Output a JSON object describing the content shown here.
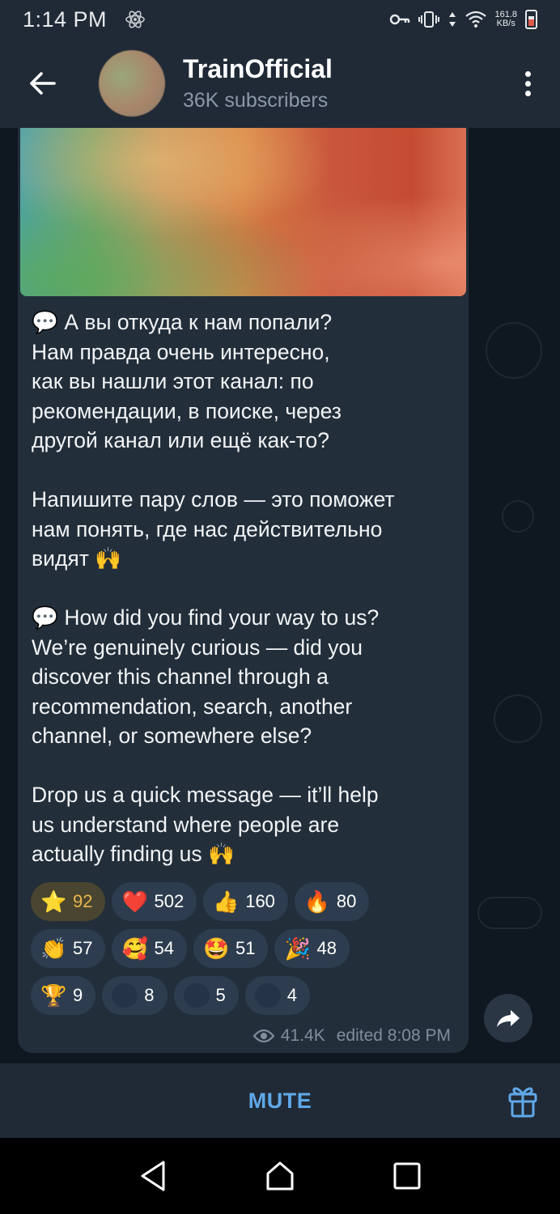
{
  "status_bar": {
    "time": "1:14 PM",
    "net_speed_value": "161.8",
    "net_speed_unit": "KB/s"
  },
  "header": {
    "channel_name": "TrainOfficial",
    "subscribers": "36K subscribers"
  },
  "message": {
    "text": "💬 А вы откуда к нам попали?\nНам правда очень интересно,\nкак вы нашли этот канал: по\nрекомендации, в поиске, через\nдругой канал или ещё как-то?\n\nНапишите пару слов — это поможет\nнам понять, где нас действительно\nвидят 🙌\n\n💬 How did you find your way to us?\nWe’re genuinely curious — did you\ndiscover this channel through a\nrecommendation, search, another\nchannel, or somewhere else?\n\nDrop us a quick message — it’ll help\nus understand where people are\nactually finding us 🙌",
    "views": "41.4K",
    "edited_time": "edited 8:08 PM"
  },
  "reactions": {
    "row1": [
      {
        "emoji": "⭐",
        "count": "92"
      },
      {
        "emoji": "❤️",
        "count": "502"
      },
      {
        "emoji": "👍",
        "count": "160"
      },
      {
        "emoji": "🔥",
        "count": "80"
      }
    ],
    "row2": [
      {
        "emoji": "👏",
        "count": "57"
      },
      {
        "emoji": "🥰",
        "count": "54"
      },
      {
        "emoji": "🤩",
        "count": "51"
      },
      {
        "emoji": "🎉",
        "count": "48"
      }
    ],
    "row3": [
      {
        "emoji": "🏆",
        "count": "9"
      },
      {
        "emoji": "",
        "count": "8"
      },
      {
        "emoji": "",
        "count": "5"
      },
      {
        "emoji": "",
        "count": "4"
      }
    ]
  },
  "bottom_bar": {
    "mute_label": "MUTE"
  },
  "colors": {
    "accent": "#5fa8e8",
    "header_bg": "#202a36",
    "bubble_bg": "#222e3a",
    "reaction_bg": "#2d3d4f",
    "star_reaction_text": "#e8b64a"
  },
  "icons": [
    "back-arrow-icon",
    "more-vert-icon",
    "eye-icon",
    "share-icon",
    "gift-icon",
    "nav-back-icon",
    "nav-home-icon",
    "nav-recents-icon"
  ]
}
